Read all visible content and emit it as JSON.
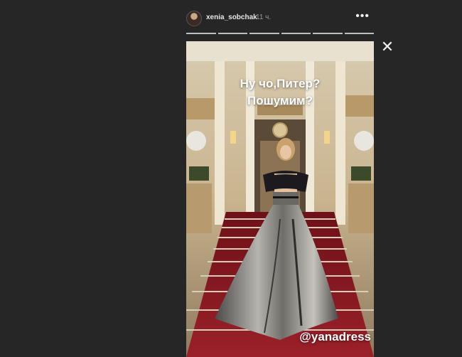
{
  "header": {
    "username": "xenia_sobchak",
    "timestamp": "11 ч.",
    "more_icon": "more-horizontal-icon",
    "close_icon": "close-icon"
  },
  "progress": {
    "segments": 6
  },
  "story": {
    "caption_line1": "Ну чо,Питер?",
    "caption_line2": "Пошумим?",
    "mention": "@yanadress"
  },
  "colors": {
    "background": "#262626",
    "carpet": "#8a1a22",
    "marble": "#e6dcc6"
  }
}
